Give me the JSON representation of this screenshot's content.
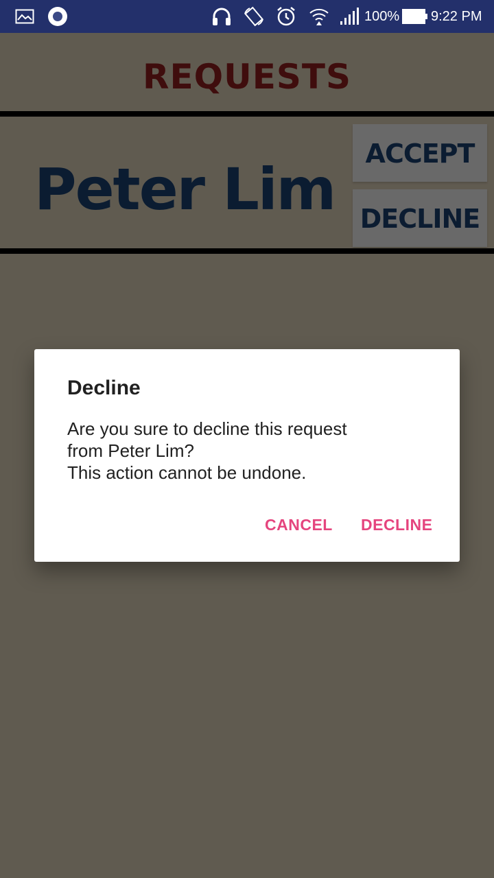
{
  "status_bar": {
    "icons": [
      "image-icon",
      "record-icon",
      "headphones-icon",
      "rotate-icon",
      "alarm-icon",
      "wifi-icon",
      "signal-icon",
      "battery-icon"
    ],
    "battery_percent": "100%",
    "time": "9:22 PM"
  },
  "header": {
    "title": "REQUESTS"
  },
  "request": {
    "name": "Peter Lim",
    "accept_label": "ACCEPT",
    "decline_label": "DECLINE"
  },
  "dialog": {
    "title": "Decline",
    "message": "Are you sure to decline this request\nfrom Peter Lim?\nThis action cannot be undone.",
    "cancel_label": "CANCEL",
    "decline_label": "DECLINE"
  },
  "colors": {
    "status_bar_bg": "#23306b",
    "page_bg": "#b9ae9a",
    "header_title": "#7a1a1a",
    "name_text": "#16365f",
    "button_bg": "#c9c9c9",
    "dialog_accent": "#e5457e"
  }
}
